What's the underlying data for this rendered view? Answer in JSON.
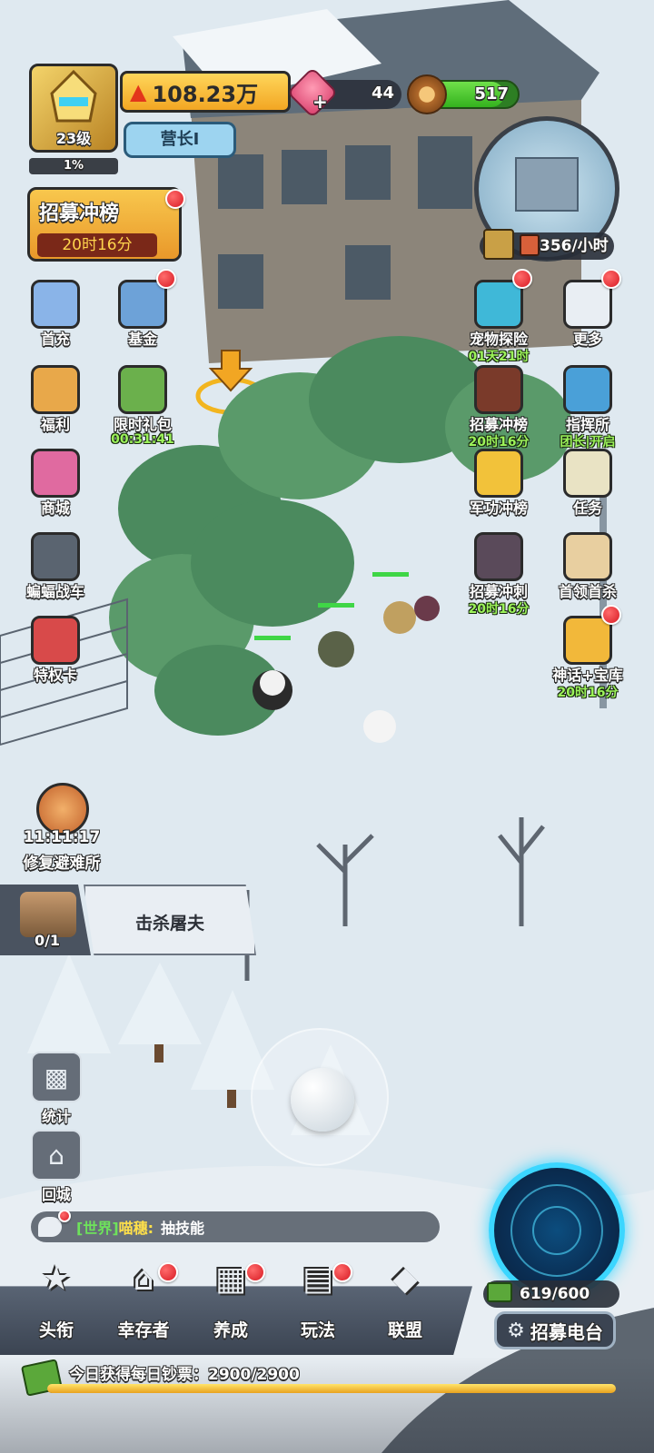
{
  "player": {
    "level": "23级",
    "exp_percent": "1%",
    "power": "108.23万",
    "rank": "营长Ⅰ",
    "gems": "44",
    "wood": "517",
    "wood_fill_fraction": 0.86,
    "production_rate": "356/小时"
  },
  "event_banner": {
    "title": "招募冲榜",
    "timer": "20时16分"
  },
  "left_menu": [
    {
      "label": "首充",
      "sub": "",
      "icon": "mecha-hero-icon",
      "color": "#8ab4e8"
    },
    {
      "label": "基金",
      "sub": "",
      "icon": "fund-book-icon",
      "color": "#6da2d8"
    },
    {
      "label": "福利",
      "sub": "",
      "icon": "balloon-basket-icon",
      "color": "#e8a84a"
    },
    {
      "label": "限时礼包",
      "sub": "00:31:41",
      "icon": "cash-gift-icon",
      "color": "#6bb04c"
    },
    {
      "label": "商城",
      "sub": "",
      "icon": "shop-basket-icon",
      "color": "#e06aa0"
    },
    {
      "label": "蝙蝠战车",
      "sub": "",
      "icon": "bat-car-icon",
      "color": "#5a6470"
    },
    {
      "label": "特权卡",
      "sub": "",
      "icon": "privilege-card-icon",
      "color": "#d84a4a"
    }
  ],
  "right_menu": [
    {
      "label": "宠物探险",
      "sub": "01天21时",
      "icon": "pet-bird-icon",
      "color": "#3fb8d8"
    },
    {
      "label": "更多",
      "sub": "",
      "icon": "grid-more-icon",
      "color": "#e9eef3"
    },
    {
      "label": "招募冲榜",
      "sub": "20时16分",
      "icon": "recruit-rank-icon",
      "color": "#7a3a2a"
    },
    {
      "label": "指挥所",
      "sub": "团长|开启",
      "icon": "command-post-icon",
      "color": "#4aa0d8"
    },
    {
      "label": "军功冲榜",
      "sub": "",
      "icon": "military-medal-icon",
      "color": "#f2c23a"
    },
    {
      "label": "任务",
      "sub": "",
      "icon": "task-list-icon",
      "color": "#e9e3c4"
    },
    {
      "label": "招募冲刺",
      "sub": "20时16分",
      "icon": "recruit-sprint-icon",
      "color": "#5a4a5a"
    },
    {
      "label": "首领首杀",
      "sub": "",
      "icon": "wanted-poster-icon",
      "color": "#e8cfa0"
    },
    {
      "label": "神话+宝库",
      "sub": "20时16分",
      "icon": "mystery-box-icon",
      "color": "#f2b83a"
    }
  ],
  "repair": {
    "timer": "11:11:17",
    "label": "修复避难所"
  },
  "quest": {
    "count": "0/1",
    "text": "击杀屠夫"
  },
  "side_buttons": {
    "stats": "统计",
    "home": "回城"
  },
  "chat": {
    "channel": "[世界]",
    "user": "喵穗:",
    "message": "抽技能"
  },
  "radar": {
    "count": "619/600",
    "button": "招募电台"
  },
  "bottom_nav": [
    {
      "label": "头衔",
      "icon": "star-badge-icon"
    },
    {
      "label": "幸存者",
      "icon": "survivor-hat-icon"
    },
    {
      "label": "养成",
      "icon": "grid-grow-icon"
    },
    {
      "label": "玩法",
      "icon": "book-play-icon"
    },
    {
      "label": "联盟",
      "icon": "shield-alliance-icon"
    }
  ],
  "daily": {
    "text": "今日获得每日钞票：2900/2900",
    "fill_fraction": 1.0
  },
  "colors": {
    "snow": "#dde7ee",
    "accent_gold": "#f2a623",
    "radar_glow": "#3bd6ff"
  }
}
